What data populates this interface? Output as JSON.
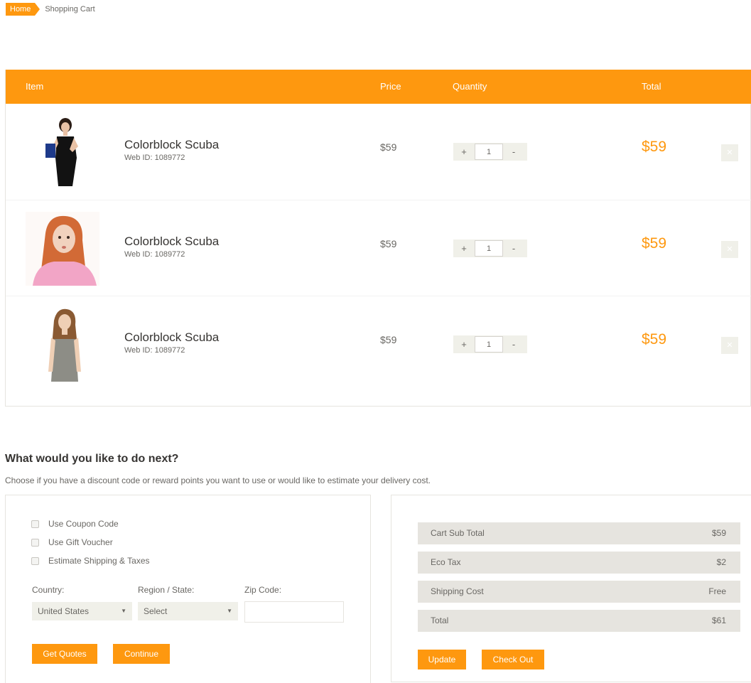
{
  "breadcrumb": {
    "home": "Home",
    "current": "Shopping Cart"
  },
  "cart": {
    "headers": {
      "item": "Item",
      "price": "Price",
      "quantity": "Quantity",
      "total": "Total"
    },
    "items": [
      {
        "name": "Colorblock Scuba",
        "web_id": "Web ID: 1089772",
        "price": "$59",
        "quantity": "1",
        "total": "$59",
        "plus": "+",
        "minus": "-",
        "remove": "✕"
      },
      {
        "name": "Colorblock Scuba",
        "web_id": "Web ID: 1089772",
        "price": "$59",
        "quantity": "1",
        "total": "$59",
        "plus": "+",
        "minus": "-",
        "remove": "✕"
      },
      {
        "name": "Colorblock Scuba",
        "web_id": "Web ID: 1089772",
        "price": "$59",
        "quantity": "1",
        "total": "$59",
        "plus": "+",
        "minus": "-",
        "remove": "✕"
      }
    ]
  },
  "next": {
    "title": "What would you like to do next?",
    "description": "Choose if you have a discount code or reward points you want to use or would like to estimate your delivery cost.",
    "options": [
      "Use Coupon Code",
      "Use Gift Voucher",
      "Estimate Shipping & Taxes"
    ],
    "country_label": "Country:",
    "country_value": "United States",
    "region_label": "Region / State:",
    "region_value": "Select",
    "zip_label": "Zip Code:",
    "zip_value": "",
    "get_quotes": "Get Quotes",
    "continue": "Continue"
  },
  "summary": {
    "rows": [
      {
        "label": "Cart Sub Total",
        "value": "$59"
      },
      {
        "label": "Eco Tax",
        "value": "$2"
      },
      {
        "label": "Shipping Cost",
        "value": "Free"
      },
      {
        "label": "Total",
        "value": "$61"
      }
    ],
    "update": "Update",
    "check_out": "Check Out"
  },
  "colors": {
    "accent": "#FE980F",
    "panel": "#F0F0E9",
    "summary_row": "#E6E4DF",
    "text": "#696763"
  },
  "icons": {
    "select_arrow": "chevron-down-icon",
    "remove": "close-icon"
  }
}
